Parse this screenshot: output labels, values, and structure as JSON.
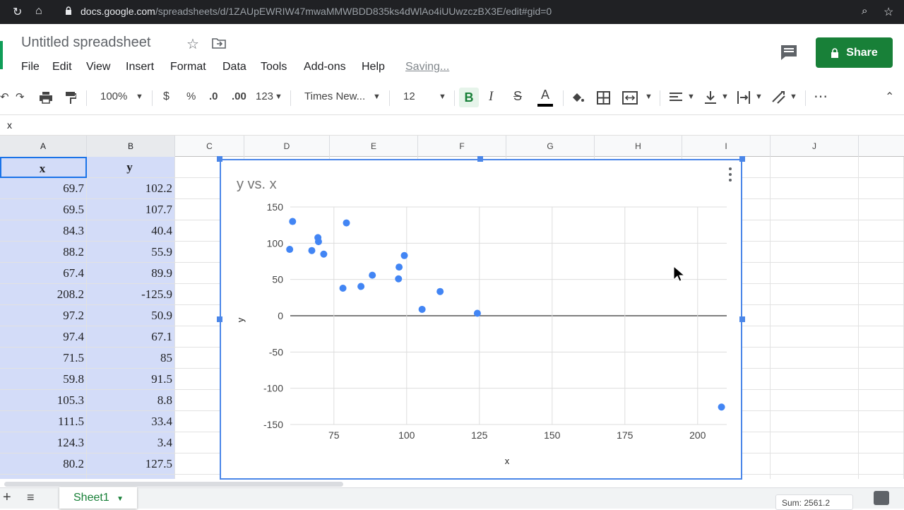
{
  "browser": {
    "url_host": "docs.google.com",
    "url_path": "/spreadsheets/d/1ZAUpEWRIW47mwaMMWBDD835ks4dWlAo4iUUwzczBX3E/edit#gid=0"
  },
  "header": {
    "title": "Untitled spreadsheet",
    "saving_status": "Saving...",
    "share_label": "Share"
  },
  "menu": [
    "File",
    "Edit",
    "View",
    "Insert",
    "Format",
    "Data",
    "Tools",
    "Add-ons",
    "Help"
  ],
  "toolbar": {
    "zoom": "100%",
    "currency": "$",
    "percent": "%",
    "dec_less": ".0",
    "dec_more": ".00",
    "more_formats": "123",
    "font": "Times New...",
    "font_size": "12",
    "bold": "B",
    "italic": "I",
    "strike": "S",
    "text_color": "A",
    "more": "⋯"
  },
  "formula_bar": {
    "value": "x"
  },
  "columns": [
    "A",
    "B",
    "C",
    "D",
    "E",
    "F",
    "G",
    "H",
    "I",
    "J"
  ],
  "table": {
    "headers": [
      "x",
      "y"
    ],
    "rows": [
      [
        "69.7",
        "102.2"
      ],
      [
        "69.5",
        "107.7"
      ],
      [
        "84.3",
        "40.4"
      ],
      [
        "88.2",
        "55.9"
      ],
      [
        "67.4",
        "89.9"
      ],
      [
        "208.2",
        "-125.9"
      ],
      [
        "97.2",
        "50.9"
      ],
      [
        "97.4",
        "67.1"
      ],
      [
        "71.5",
        "85"
      ],
      [
        "59.8",
        "91.5"
      ],
      [
        "105.3",
        "8.8"
      ],
      [
        "111.5",
        "33.4"
      ],
      [
        "124.3",
        "3.4"
      ],
      [
        "80.2",
        "127.5"
      ]
    ]
  },
  "sheet_tab": "Sheet1",
  "sum": "Sum: 2561.2",
  "colors": {
    "accent": "#188038",
    "selection": "#d3dcf8",
    "series": "#4285f4",
    "chart_border": "#4a86e8"
  },
  "chart_data": {
    "type": "scatter",
    "title": "y vs. x",
    "xlabel": "x",
    "ylabel": "y",
    "xlim": [
      60,
      210
    ],
    "ylim": [
      -150,
      150
    ],
    "xticks": [
      "75",
      "100",
      "125",
      "150",
      "175",
      "200"
    ],
    "yticks": [
      "150",
      "100",
      "50",
      "0",
      "-50",
      "-100",
      "-150"
    ],
    "grid": true,
    "points": [
      [
        60.8,
        130
      ],
      [
        59.8,
        91.5
      ],
      [
        67.4,
        89.9
      ],
      [
        69.5,
        107.7
      ],
      [
        69.7,
        102.2
      ],
      [
        71.5,
        85
      ],
      [
        79.3,
        128
      ],
      [
        78.1,
        38
      ],
      [
        84.3,
        40.4
      ],
      [
        88.2,
        55.9
      ],
      [
        97.2,
        50.9
      ],
      [
        97.4,
        67.1
      ],
      [
        99.2,
        83
      ],
      [
        105.3,
        8.8
      ],
      [
        111.5,
        33.4
      ],
      [
        124.3,
        3.4
      ],
      [
        208.2,
        -125.9
      ]
    ]
  }
}
